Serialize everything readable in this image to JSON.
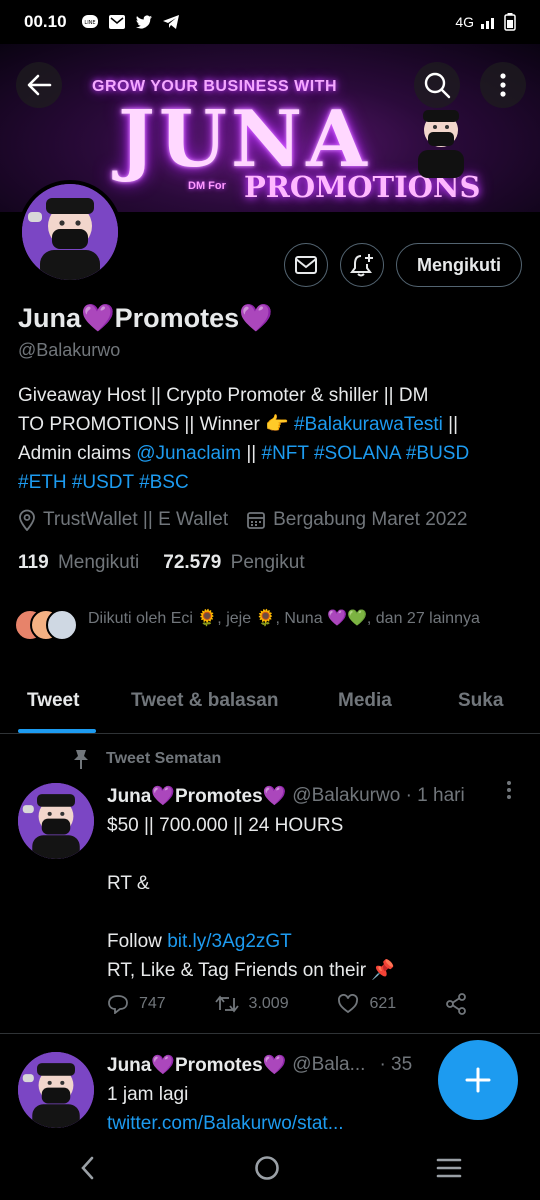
{
  "status_bar": {
    "time": "00.10",
    "network": "4G",
    "icons": [
      "line-icon",
      "mail-icon",
      "twitter-icon",
      "telegram-icon",
      "signal-icon",
      "battery-icon"
    ]
  },
  "banner": {
    "line1": "GROW YOUR BUSINESS WITH",
    "line2": "JUNA",
    "line3_small": "DM For",
    "line3": "PROMOTIONS"
  },
  "actions": {
    "follow_label": "Mengikuti"
  },
  "profile": {
    "name": "Juna💜Promotes💜",
    "handle": "@Balakurwo",
    "bio_1": "Giveaway Host || Crypto Promoter & shiller || DM",
    "bio_2": "TO PROMOTIONS || Winner 👉 ",
    "bio_2_link": "#BalakurawaTesti",
    "bio_2_end": " ||",
    "bio_3": "Admin claims ",
    "bio_3_link": "@Junaclaim",
    "bio_3_mid": " || ",
    "bio_3_tags": "#NFT #SOLANA #BUSD",
    "bio_4_tags": "#ETH #USDT #BSC",
    "location": "TrustWallet || E Wallet",
    "joined": "Bergabung Maret 2022",
    "following_count": "119",
    "following_label": "Mengikuti",
    "followers_count": "72.579",
    "followers_label": "Pengikut",
    "followed_by": "Diikuti oleh Eci 🌻, jeje 🌻, Nuna 💜💚, dan 27 lainnya"
  },
  "tabs": [
    "Tweet",
    "Tweet & balasan",
    "Media",
    "Suka"
  ],
  "pinned_label": "Tweet Sematan",
  "tweet1": {
    "name": "Juna💜Promotes💜",
    "handle": "@Balakurwo · 1 hari",
    "line1": "$50 || 700.000 || 24 HOURS",
    "line2": "RT &",
    "line3": "Follow ",
    "line3_link": "bit.ly/3Ag2zGT",
    "line4": "RT, Like & Tag Friends on their 📌",
    "replies": "747",
    "retweets": "3.009",
    "likes": "621"
  },
  "tweet2": {
    "name": "Juna💜Promotes💜",
    "handle": "@Bala...",
    "time": "· 35",
    "line1": "1 jam lagi",
    "link": "twitter.com/Balakurwo/stat..."
  },
  "colors": {
    "accent": "#1d9bf0",
    "muted": "#71767b",
    "avatar_bg": "#7b46c4"
  }
}
